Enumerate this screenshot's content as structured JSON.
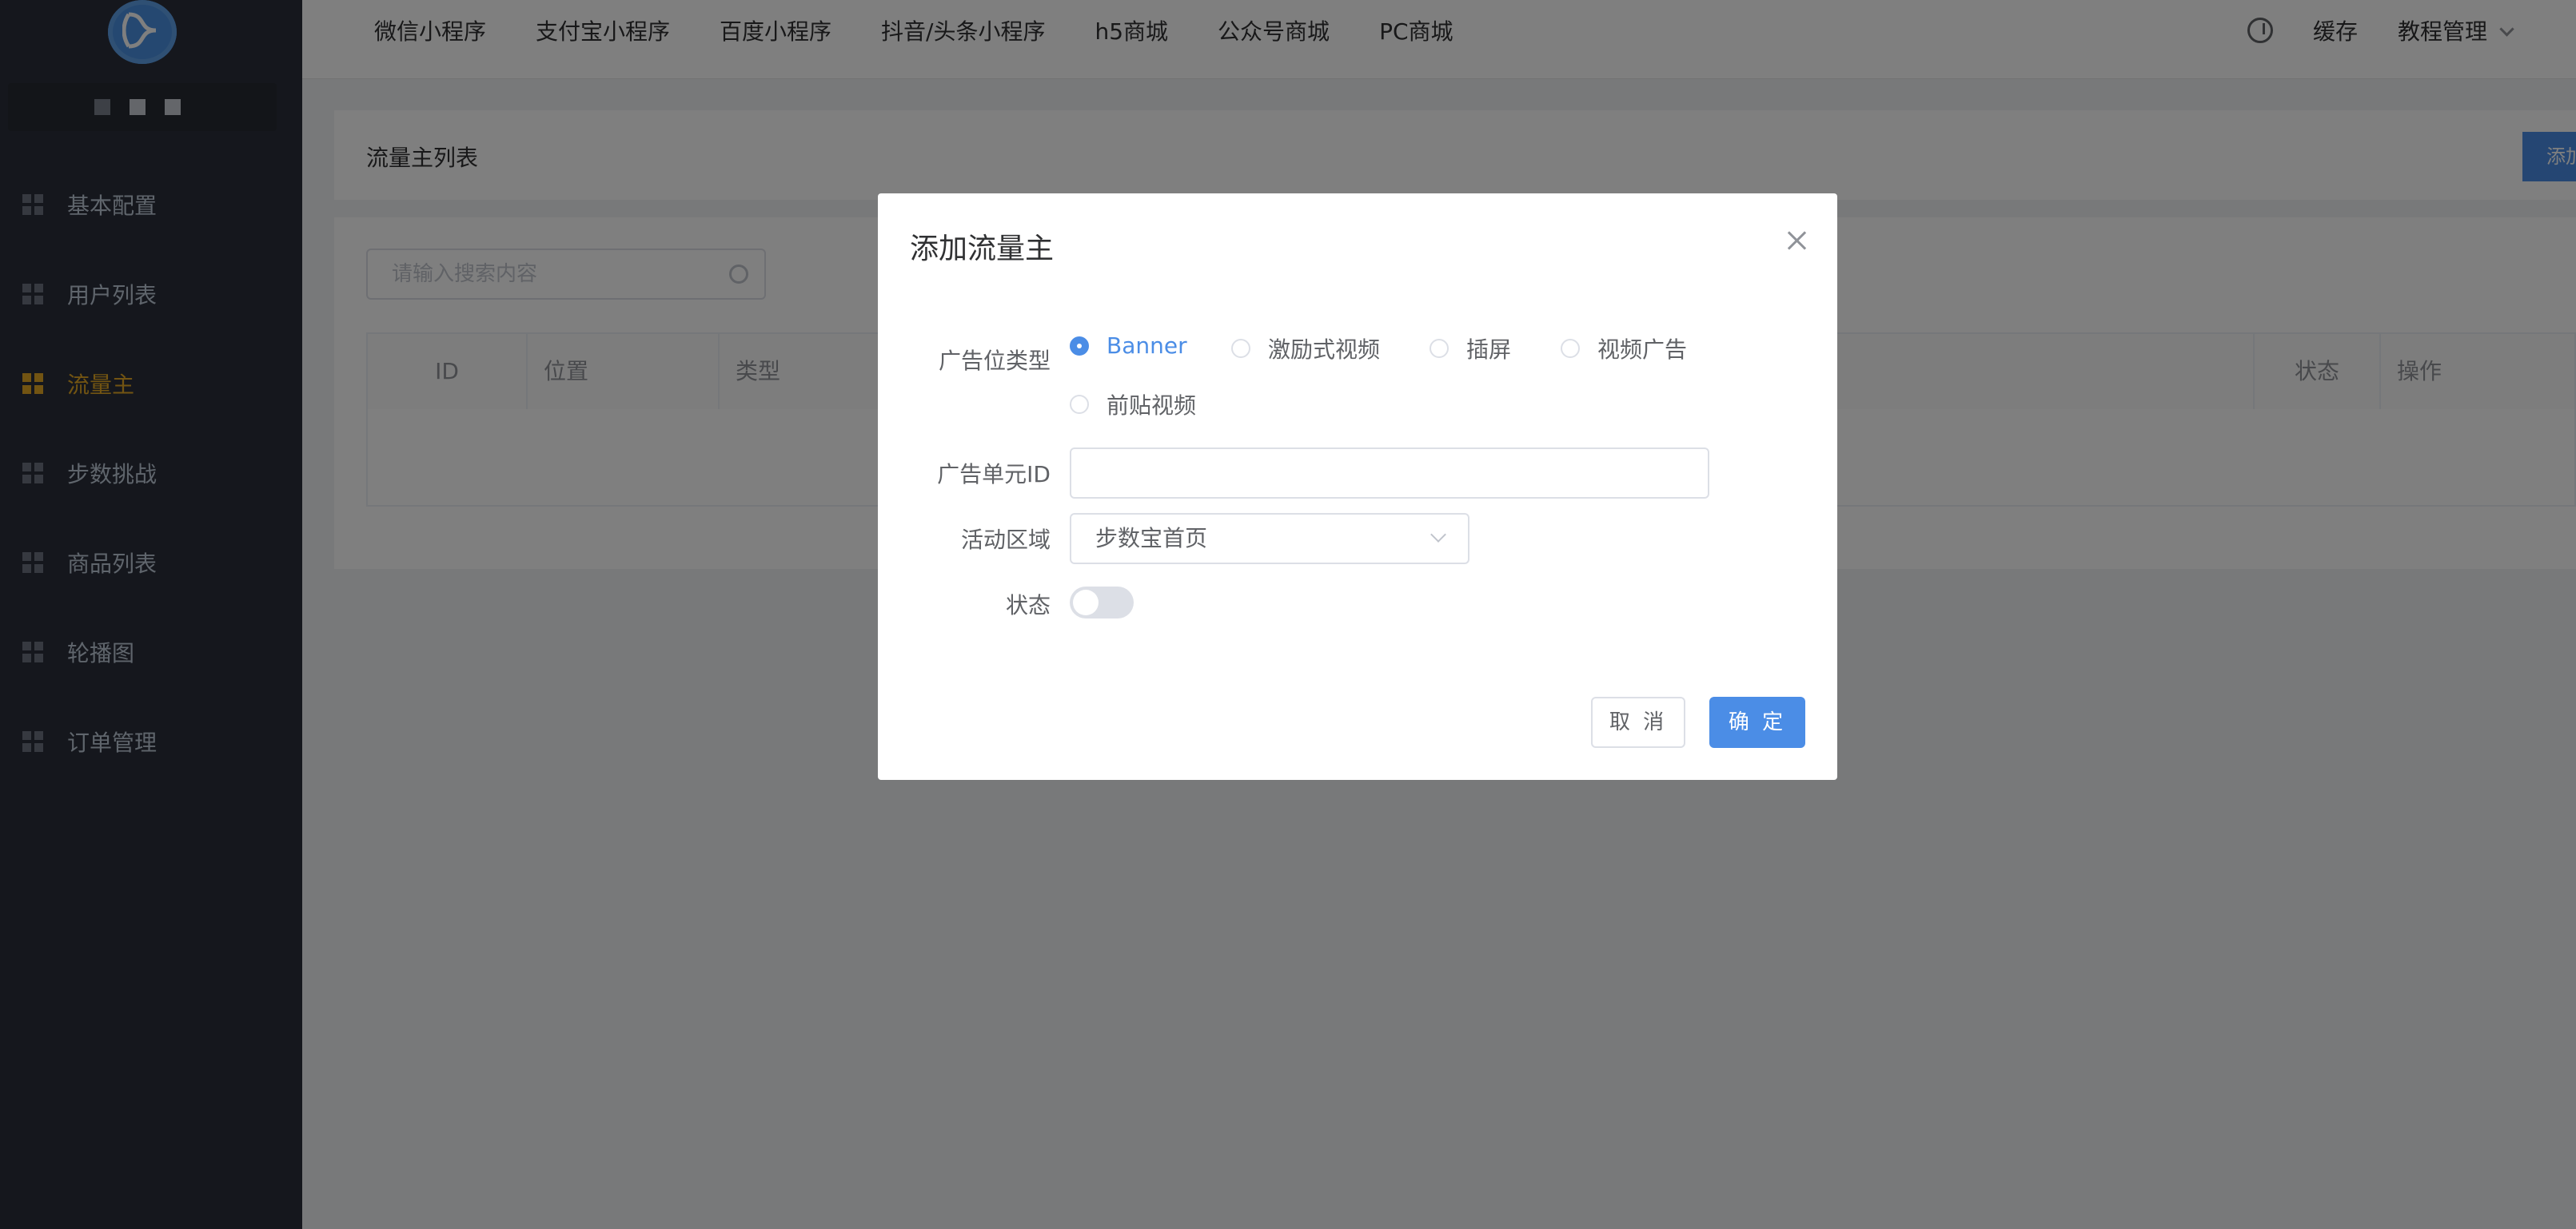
{
  "sidebar": {
    "items": [
      {
        "label": "基本配置",
        "active": false
      },
      {
        "label": "用户列表",
        "active": false
      },
      {
        "label": "流量主",
        "active": true
      },
      {
        "label": "步数挑战",
        "active": false
      },
      {
        "label": "商品列表",
        "active": false
      },
      {
        "label": "轮播图",
        "active": false
      },
      {
        "label": "订单管理",
        "active": false
      }
    ]
  },
  "topbar": {
    "tabs": [
      "微信小程序",
      "支付宝小程序",
      "百度小程序",
      "抖音/头条小程序",
      "h5商城",
      "公众号商城",
      "PC商城"
    ],
    "cache": "缓存",
    "user_menu": "教程管理"
  },
  "page": {
    "title": "流量主列表",
    "add_button": "添加",
    "search_placeholder": "请输入搜索内容",
    "columns": [
      "ID",
      "位置",
      "类型",
      "状态",
      "操作"
    ]
  },
  "dialog": {
    "title": "添加流量主",
    "ad_type_label": "广告位类型",
    "ad_types": [
      "Banner",
      "激励式视频",
      "插屏",
      "视频广告",
      "前贴视频"
    ],
    "ad_type_selected": "Banner",
    "ad_unit_label": "广告单元ID",
    "ad_unit_value": "",
    "region_label": "活动区域",
    "region_value": "步数宝首页",
    "status_label": "状态",
    "status_on": false,
    "cancel": "取 消",
    "ok": "确 定"
  },
  "colors": {
    "sidebar_bg": "#2b2f3a",
    "active": "#e4a824",
    "primary": "#4b8de6"
  }
}
